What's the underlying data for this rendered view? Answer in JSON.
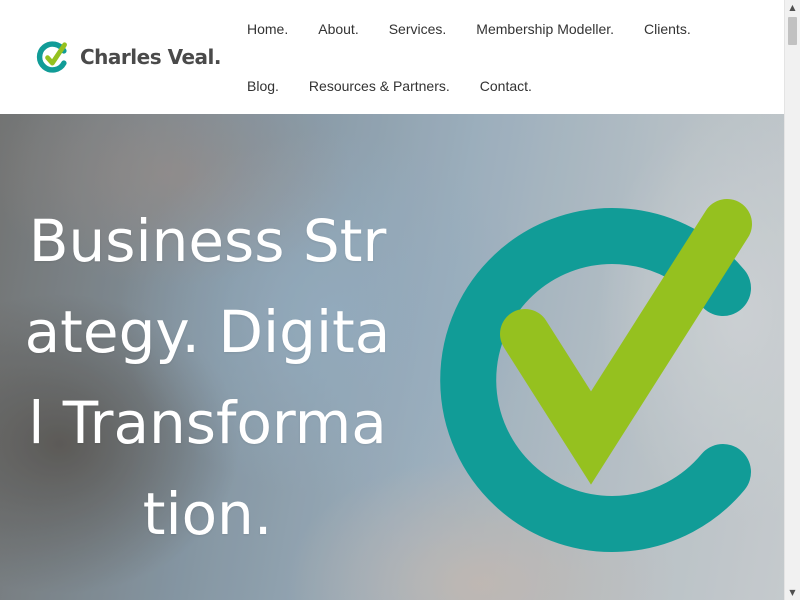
{
  "header": {
    "logo": {
      "text": "Charles Veal.",
      "icon": "check-circle-logo-icon"
    },
    "nav": {
      "row1": [
        "Home.",
        "About.",
        "Services.",
        "Membership Modeller.",
        "Clients."
      ],
      "row2": [
        "Blog.",
        "Resources & Partners.",
        "Contact."
      ]
    }
  },
  "hero": {
    "title": "Business Strategy. Digital Transformation.",
    "graphic": "check-circle-icon"
  },
  "colors": {
    "teal": "#119c97",
    "green": "#95c11f",
    "logo_text": "#4a4a4a",
    "nav_text": "#333333"
  }
}
